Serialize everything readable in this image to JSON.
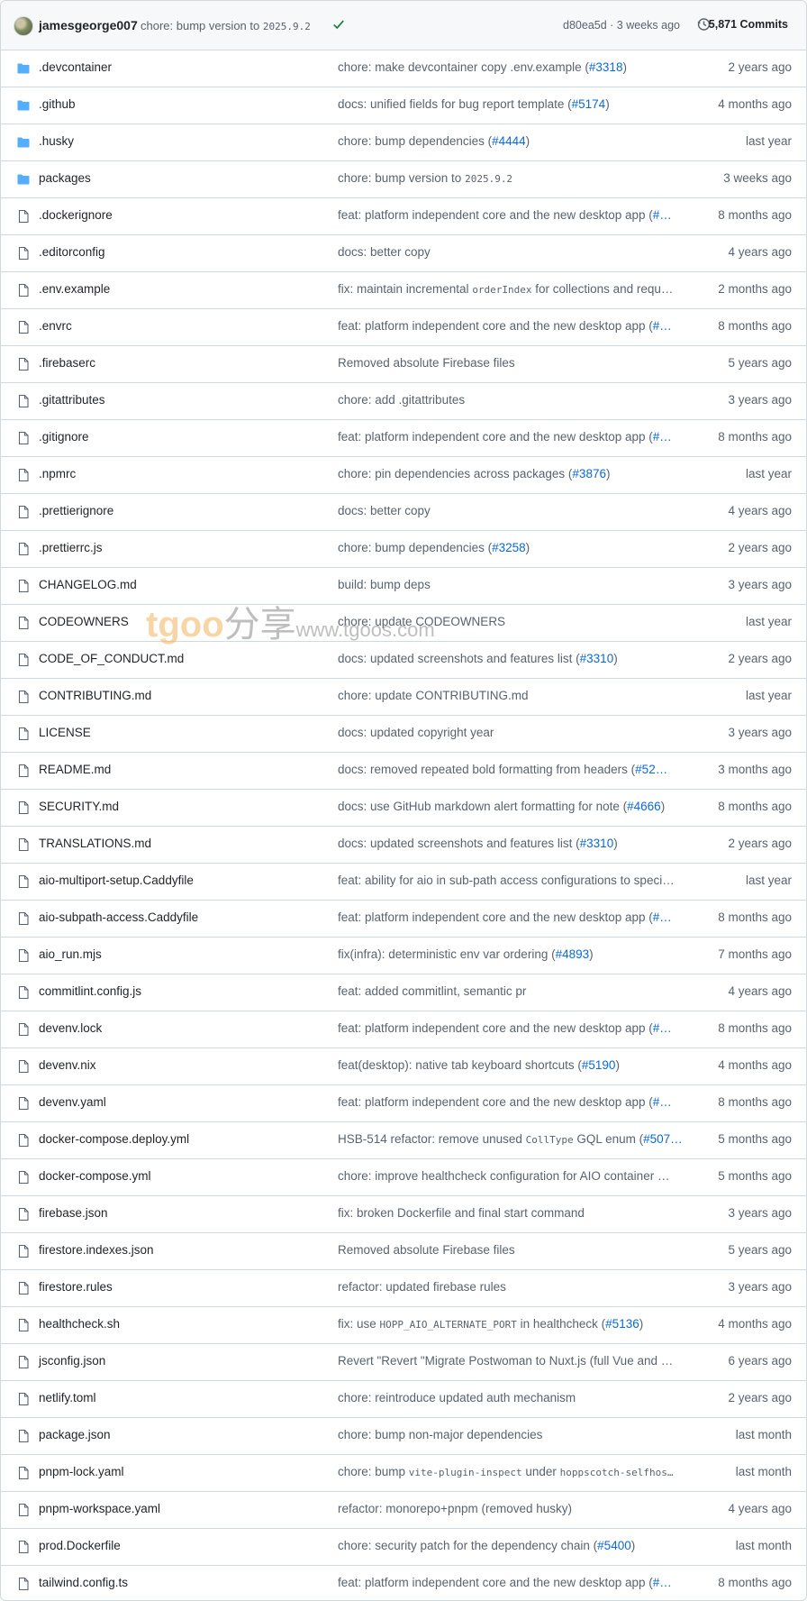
{
  "header": {
    "author": "jamesgeorge007",
    "commit_prefix": "chore: bump version to ",
    "commit_code": "2025.9.2",
    "sha_time": "d80ea5d · 3 weeks ago",
    "commits": "5,871 Commits"
  },
  "watermark": {
    "brand": "tgoo",
    "cn": "分享",
    "url": "www.tgoos.com"
  },
  "colors": {
    "folder": "#54aeff",
    "link": "#0969da",
    "muted": "#59636e",
    "success": "#1a7f37"
  },
  "files": [
    {
      "name": ".devcontainer",
      "type": "folder",
      "msg": [
        [
          "t",
          "chore: make devcontainer copy .env.example ("
        ],
        [
          "pr",
          "#3318"
        ],
        [
          "t",
          ")"
        ]
      ],
      "age": "2 years ago"
    },
    {
      "name": ".github",
      "type": "folder",
      "msg": [
        [
          "t",
          "docs: unified fields for bug report template ("
        ],
        [
          "pr",
          "#5174"
        ],
        [
          "t",
          ")"
        ]
      ],
      "age": "4 months ago"
    },
    {
      "name": ".husky",
      "type": "folder",
      "msg": [
        [
          "t",
          "chore: bump dependencies ("
        ],
        [
          "pr",
          "#4444"
        ],
        [
          "t",
          ")"
        ]
      ],
      "age": "last year"
    },
    {
      "name": "packages",
      "type": "folder",
      "msg": [
        [
          "t",
          "chore: bump version to "
        ],
        [
          "c",
          "2025.9.2"
        ]
      ],
      "age": "3 weeks ago"
    },
    {
      "name": ".dockerignore",
      "type": "file",
      "msg": [
        [
          "t",
          "feat: platform independent core and the new desktop app ("
        ],
        [
          "pr",
          "#…"
        ]
      ],
      "age": "8 months ago"
    },
    {
      "name": ".editorconfig",
      "type": "file",
      "msg": [
        [
          "t",
          "docs: better copy"
        ]
      ],
      "age": "4 years ago"
    },
    {
      "name": ".env.example",
      "type": "file",
      "msg": [
        [
          "t",
          "fix: maintain incremental "
        ],
        [
          "c",
          "orderIndex"
        ],
        [
          "t",
          " for collections and requ…"
        ]
      ],
      "age": "2 months ago"
    },
    {
      "name": ".envrc",
      "type": "file",
      "msg": [
        [
          "t",
          "feat: platform independent core and the new desktop app ("
        ],
        [
          "pr",
          "#…"
        ]
      ],
      "age": "8 months ago"
    },
    {
      "name": ".firebaserc",
      "type": "file",
      "msg": [
        [
          "t",
          "Removed absolute Firebase files"
        ]
      ],
      "age": "5 years ago"
    },
    {
      "name": ".gitattributes",
      "type": "file",
      "msg": [
        [
          "t",
          "chore: add .gitattributes"
        ]
      ],
      "age": "3 years ago"
    },
    {
      "name": ".gitignore",
      "type": "file",
      "msg": [
        [
          "t",
          "feat: platform independent core and the new desktop app ("
        ],
        [
          "pr",
          "#…"
        ]
      ],
      "age": "8 months ago"
    },
    {
      "name": ".npmrc",
      "type": "file",
      "msg": [
        [
          "t",
          "chore: pin dependencies across packages ("
        ],
        [
          "pr",
          "#3876"
        ],
        [
          "t",
          ")"
        ]
      ],
      "age": "last year"
    },
    {
      "name": ".prettierignore",
      "type": "file",
      "msg": [
        [
          "t",
          "docs: better copy"
        ]
      ],
      "age": "4 years ago"
    },
    {
      "name": ".prettierrc.js",
      "type": "file",
      "msg": [
        [
          "t",
          "chore: bump dependencies ("
        ],
        [
          "pr",
          "#3258"
        ],
        [
          "t",
          ")"
        ]
      ],
      "age": "2 years ago"
    },
    {
      "name": "CHANGELOG.md",
      "type": "file",
      "msg": [
        [
          "t",
          "build: bump deps"
        ]
      ],
      "age": "3 years ago"
    },
    {
      "name": "CODEOWNERS",
      "type": "file",
      "msg": [
        [
          "t",
          "chore: update CODEOWNERS"
        ]
      ],
      "age": "last year"
    },
    {
      "name": "CODE_OF_CONDUCT.md",
      "type": "file",
      "msg": [
        [
          "t",
          "docs: updated screenshots and features list ("
        ],
        [
          "pr",
          "#3310"
        ],
        [
          "t",
          ")"
        ]
      ],
      "age": "2 years ago"
    },
    {
      "name": "CONTRIBUTING.md",
      "type": "file",
      "msg": [
        [
          "t",
          "chore: update CONTRIBUTING.md"
        ]
      ],
      "age": "last year"
    },
    {
      "name": "LICENSE",
      "type": "file",
      "msg": [
        [
          "t",
          "docs: updated copyright year"
        ]
      ],
      "age": "3 years ago"
    },
    {
      "name": "README.md",
      "type": "file",
      "msg": [
        [
          "t",
          "docs: removed repeated bold formatting from headers ("
        ],
        [
          "pr",
          "#52…"
        ]
      ],
      "age": "3 months ago"
    },
    {
      "name": "SECURITY.md",
      "type": "file",
      "msg": [
        [
          "t",
          "docs: use GitHub markdown alert formatting for note ("
        ],
        [
          "pr",
          "#4666"
        ],
        [
          "t",
          ")"
        ]
      ],
      "age": "8 months ago"
    },
    {
      "name": "TRANSLATIONS.md",
      "type": "file",
      "msg": [
        [
          "t",
          "docs: updated screenshots and features list ("
        ],
        [
          "pr",
          "#3310"
        ],
        [
          "t",
          ")"
        ]
      ],
      "age": "2 years ago"
    },
    {
      "name": "aio-multiport-setup.Caddyfile",
      "type": "file",
      "msg": [
        [
          "t",
          "feat: ability for aio in sub-path access configurations to speci…"
        ]
      ],
      "age": "last year"
    },
    {
      "name": "aio-subpath-access.Caddyfile",
      "type": "file",
      "msg": [
        [
          "t",
          "feat: platform independent core and the new desktop app ("
        ],
        [
          "pr",
          "#…"
        ]
      ],
      "age": "8 months ago"
    },
    {
      "name": "aio_run.mjs",
      "type": "file",
      "msg": [
        [
          "t",
          "fix(infra): deterministic env var ordering ("
        ],
        [
          "pr",
          "#4893"
        ],
        [
          "t",
          ")"
        ]
      ],
      "age": "7 months ago"
    },
    {
      "name": "commitlint.config.js",
      "type": "file",
      "msg": [
        [
          "t",
          "feat: added commitlint, semantic pr"
        ]
      ],
      "age": "4 years ago"
    },
    {
      "name": "devenv.lock",
      "type": "file",
      "msg": [
        [
          "t",
          "feat: platform independent core and the new desktop app ("
        ],
        [
          "pr",
          "#…"
        ]
      ],
      "age": "8 months ago"
    },
    {
      "name": "devenv.nix",
      "type": "file",
      "msg": [
        [
          "t",
          "feat(desktop): native tab keyboard shortcuts ("
        ],
        [
          "pr",
          "#5190"
        ],
        [
          "t",
          ")"
        ]
      ],
      "age": "4 months ago"
    },
    {
      "name": "devenv.yaml",
      "type": "file",
      "msg": [
        [
          "t",
          "feat: platform independent core and the new desktop app ("
        ],
        [
          "pr",
          "#…"
        ]
      ],
      "age": "8 months ago"
    },
    {
      "name": "docker-compose.deploy.yml",
      "type": "file",
      "msg": [
        [
          "t",
          "HSB-514 refactor: remove unused "
        ],
        [
          "c",
          "CollType"
        ],
        [
          "t",
          " GQL enum ("
        ],
        [
          "pr",
          "#507…"
        ]
      ],
      "age": "5 months ago"
    },
    {
      "name": "docker-compose.yml",
      "type": "file",
      "msg": [
        [
          "t",
          "chore: improve healthcheck configuration for AIO container …"
        ]
      ],
      "age": "5 months ago"
    },
    {
      "name": "firebase.json",
      "type": "file",
      "msg": [
        [
          "t",
          "fix: broken Dockerfile and final start command"
        ]
      ],
      "age": "3 years ago"
    },
    {
      "name": "firestore.indexes.json",
      "type": "file",
      "msg": [
        [
          "t",
          "Removed absolute Firebase files"
        ]
      ],
      "age": "5 years ago"
    },
    {
      "name": "firestore.rules",
      "type": "file",
      "msg": [
        [
          "t",
          "refactor: updated firebase rules"
        ]
      ],
      "age": "3 years ago"
    },
    {
      "name": "healthcheck.sh",
      "type": "file",
      "msg": [
        [
          "t",
          "fix: use "
        ],
        [
          "c",
          "HOPP_AIO_ALTERNATE_PORT"
        ],
        [
          "t",
          " in healthcheck ("
        ],
        [
          "pr",
          "#5136"
        ],
        [
          "t",
          ")"
        ]
      ],
      "age": "4 months ago"
    },
    {
      "name": "jsconfig.json",
      "type": "file",
      "msg": [
        [
          "t",
          "Revert \"Revert \"Migrate Postwoman to Nuxt.js (full Vue and …"
        ]
      ],
      "age": "6 years ago"
    },
    {
      "name": "netlify.toml",
      "type": "file",
      "msg": [
        [
          "t",
          "chore: reintroduce updated auth mechanism"
        ]
      ],
      "age": "2 years ago"
    },
    {
      "name": "package.json",
      "type": "file",
      "msg": [
        [
          "t",
          "chore: bump non-major dependencies"
        ]
      ],
      "age": "last month"
    },
    {
      "name": "pnpm-lock.yaml",
      "type": "file",
      "msg": [
        [
          "t",
          "chore: bump "
        ],
        [
          "c",
          "vite-plugin-inspect"
        ],
        [
          "t",
          " under "
        ],
        [
          "c",
          "hoppscotch-selfhos…"
        ]
      ],
      "age": "last month"
    },
    {
      "name": "pnpm-workspace.yaml",
      "type": "file",
      "msg": [
        [
          "t",
          "refactor: monorepo+pnpm (removed husky)"
        ]
      ],
      "age": "4 years ago"
    },
    {
      "name": "prod.Dockerfile",
      "type": "file",
      "msg": [
        [
          "t",
          "chore: security patch for the dependency chain ("
        ],
        [
          "pr",
          "#5400"
        ],
        [
          "t",
          ")"
        ]
      ],
      "age": "last month"
    },
    {
      "name": "tailwind.config.ts",
      "type": "file",
      "msg": [
        [
          "t",
          "feat: platform independent core and the new desktop app ("
        ],
        [
          "pr",
          "#…"
        ]
      ],
      "age": "8 months ago"
    }
  ]
}
